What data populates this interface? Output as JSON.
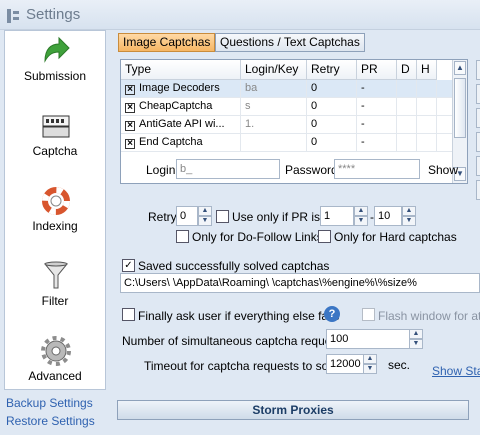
{
  "window": {
    "title": "Settings"
  },
  "sidebar": {
    "items": [
      {
        "label": "Submission",
        "icon": "green-arrow-icon"
      },
      {
        "label": "Captcha",
        "icon": "captcha-keyboard-icon"
      },
      {
        "label": "Indexing",
        "icon": "life-ring-icon"
      },
      {
        "label": "Filter",
        "icon": "funnel-icon"
      },
      {
        "label": "Advanced",
        "icon": "gear-icon"
      }
    ],
    "backup_link": "Backup Settings",
    "restore_link": "Restore Settings"
  },
  "tabs": [
    {
      "label": "Image Captchas",
      "active": true
    },
    {
      "label": "Questions / Text Captchas",
      "active": false
    }
  ],
  "grid": {
    "columns": [
      "Type",
      "Login/Key",
      "Retry",
      "PR",
      "D",
      "H"
    ],
    "rows": [
      {
        "type": "Image Decoders",
        "login": "ba",
        "retry": "0",
        "pr": "-",
        "d": "",
        "h": "",
        "checked": true,
        "selected": true
      },
      {
        "type": "CheapCaptcha",
        "login": "s",
        "retry": "0",
        "pr": "-",
        "d": "",
        "h": "",
        "checked": true,
        "selected": false
      },
      {
        "type": "AntiGate API wi...",
        "login": "1.",
        "retry": "0",
        "pr": "-",
        "d": "",
        "h": "",
        "checked": true,
        "selected": false
      },
      {
        "type": "End Captcha",
        "login": "",
        "retry": "0",
        "pr": "-",
        "d": "",
        "h": "",
        "checked": true,
        "selected": false
      }
    ]
  },
  "login": {
    "label": "Login",
    "value": "b_",
    "password_label": "Password",
    "password_value": "****",
    "show_label": "Show"
  },
  "retry": {
    "label": "Retry",
    "value": "0",
    "use_only_pr_label": "Use only if PR is",
    "pr_from": "1",
    "pr_dash": "-",
    "pr_to": "10",
    "dofollow_label": "Only for Do-Follow Links",
    "hard_label": "Only for Hard captchas"
  },
  "saved": {
    "checked": true,
    "label": "Saved successfully solved captchas",
    "path": "C:\\Users\\      \\AppData\\Roaming\\       \\captchas\\%engine%\\%size%"
  },
  "finally": {
    "label": "Finally ask user if everything else fails",
    "help_icon": "?",
    "flash_label": "Flash window for atten"
  },
  "simultaneous": {
    "label": "Number of simultaneous captcha requests",
    "value": "100"
  },
  "timeout": {
    "label": "Timeout for captcha requests to solve",
    "value": "12000",
    "unit": "sec."
  },
  "show_stats_link": "Show Stat",
  "storm_button": "Storm Proxies"
}
